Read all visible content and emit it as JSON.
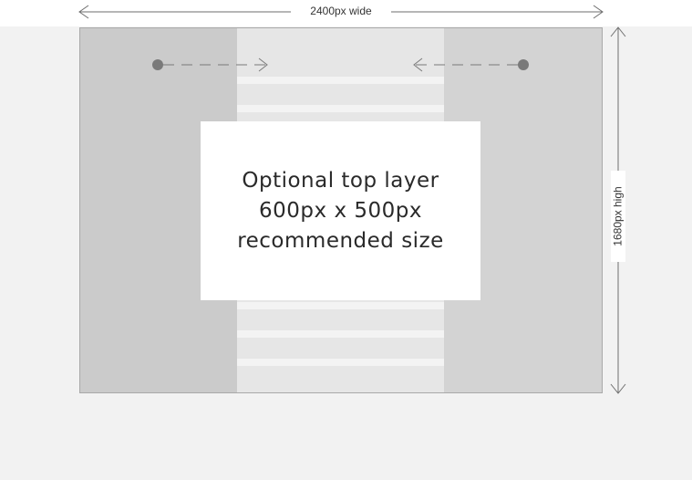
{
  "dimensions": {
    "width_label": "2400px wide",
    "height_label": "1680px high"
  },
  "top_layer": {
    "line1": "Optional top layer",
    "line2": "600px x 500px",
    "line3": "recommended size"
  },
  "icons": {
    "width_arrow": "double-headed-horizontal-arrow",
    "height_arrow": "double-headed-vertical-arrow",
    "left_slide": "dot-dashed-arrow-right",
    "right_slide": "dot-dashed-arrow-left"
  },
  "colors": {
    "side_panel": "#cbcbcb",
    "center_column": "#e6e6e6",
    "stripe": "#f3f3f3",
    "top_layer": "#ffffff",
    "marker": "#7a7a7a"
  }
}
